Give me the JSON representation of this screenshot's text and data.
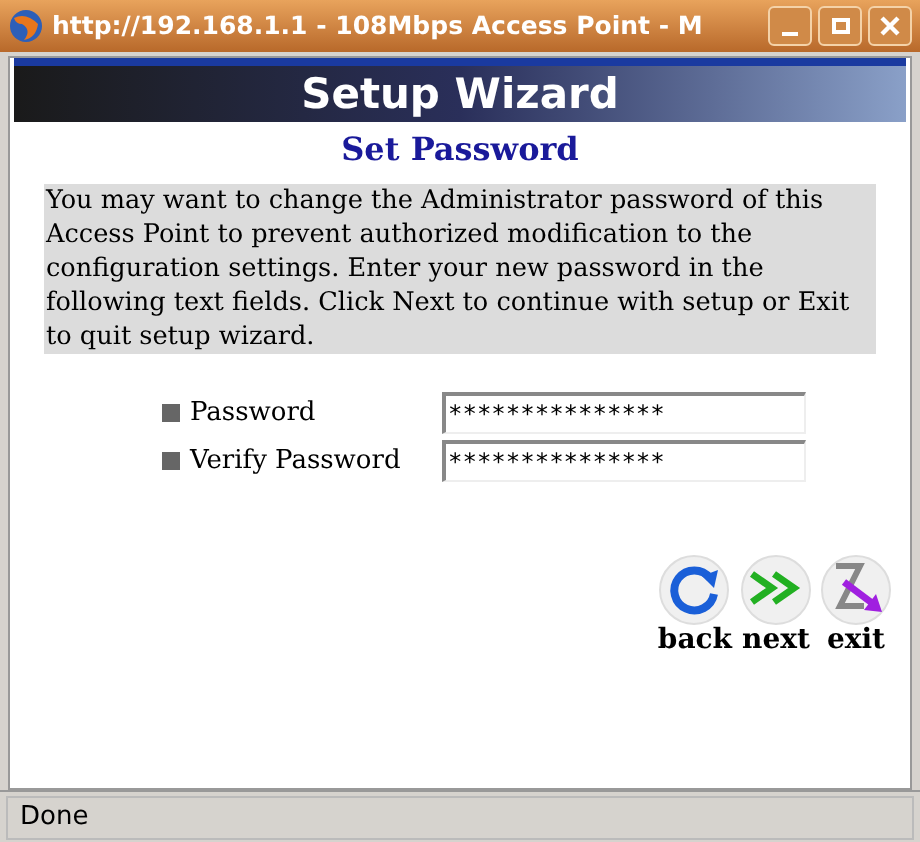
{
  "window": {
    "title": "http://192.168.1.1 - 108Mbps Access Point - M"
  },
  "banner": {
    "title": "Setup Wizard"
  },
  "heading": "Set Password",
  "description": "You may want to change the Administrator password of this Access Point to prevent authorized modification to the configuration settings. Enter your new password in the following text fields. Click Next to continue with setup or Exit to quit setup wizard.",
  "fields": [
    {
      "label": "Password",
      "value": "***************"
    },
    {
      "label": "Verify Password",
      "value": "***************"
    }
  ],
  "buttons": [
    {
      "kind": "back",
      "label": "back"
    },
    {
      "kind": "next",
      "label": "next"
    },
    {
      "kind": "exit",
      "label": "exit"
    }
  ],
  "status_bar": "Done"
}
